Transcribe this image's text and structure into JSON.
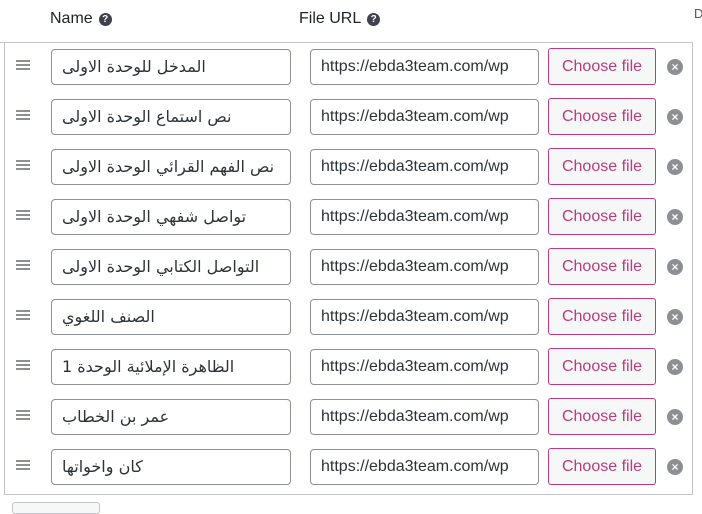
{
  "header": {
    "name_label": "Name",
    "url_label": "File URL",
    "help_icon": "?",
    "edge_letter": "D"
  },
  "choose_label": "Choose file",
  "remove_icon": "×",
  "rows": [
    {
      "name": "المدخل للوحدة الاولى",
      "url": "https://ebda3team.com/wp"
    },
    {
      "name": "نص استماع الوحدة الاولى",
      "url": "https://ebda3team.com/wp"
    },
    {
      "name": "نص الفهم القرائي الوحدة الاولى",
      "url": "https://ebda3team.com/wp"
    },
    {
      "name": "تواصل شفهي الوحدة الاولى",
      "url": "https://ebda3team.com/wp"
    },
    {
      "name": "التواصل الكتابي الوحدة الاولى",
      "url": "https://ebda3team.com/wp"
    },
    {
      "name": "الصنف اللغوي",
      "url": "https://ebda3team.com/wp"
    },
    {
      "name": "الظاهرة الإملائية الوحدة 1",
      "url": "https://ebda3team.com/wp"
    },
    {
      "name": "عمر بن الخطاب",
      "url": "https://ebda3team.com/wp"
    },
    {
      "name": "كان واخواتها",
      "url": "https://ebda3team.com/wp"
    }
  ]
}
